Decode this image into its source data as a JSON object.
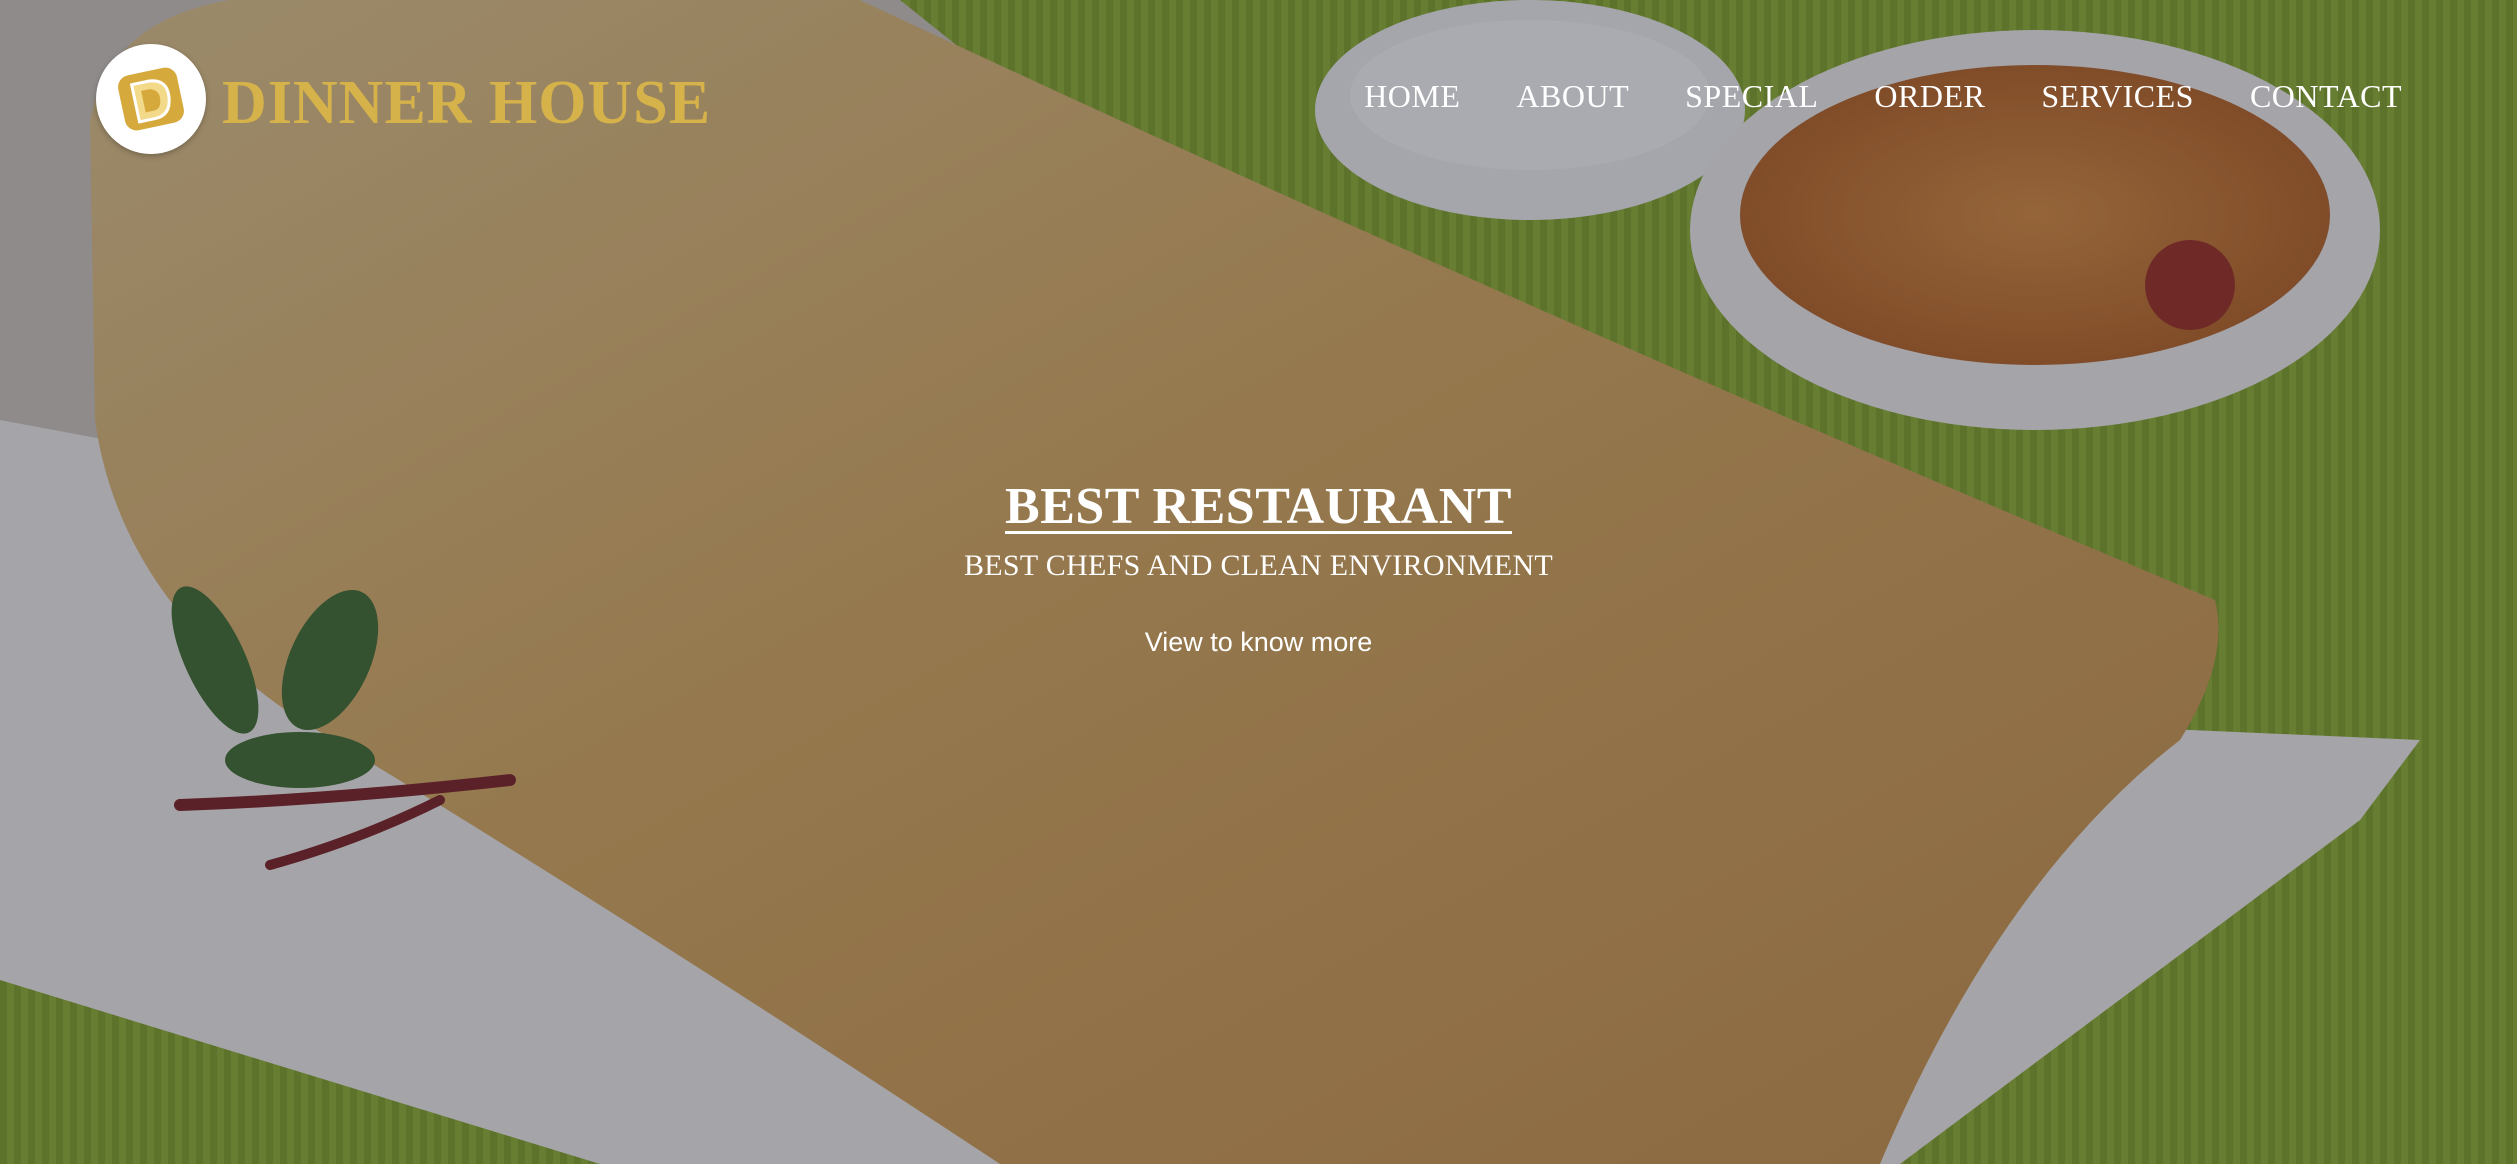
{
  "header": {
    "brand_name": "DINNER HOUSE",
    "logo_icon": "dosa-logo-icon",
    "nav": [
      {
        "label": "HOME"
      },
      {
        "label": "ABOUT"
      },
      {
        "label": "SPECIAL"
      },
      {
        "label": "ORDER"
      },
      {
        "label": "SERVICES"
      },
      {
        "label": "CONTACT"
      }
    ]
  },
  "hero": {
    "title": "BEST RESTAURANT",
    "subtitle": "BEST CHEFS AND CLEAN ENVIRONMENT",
    "cta_label": "View to know more"
  },
  "colors": {
    "brand_gold": "#d6b24a",
    "nav_text": "#ffffff",
    "overlay": "#282a3a"
  }
}
